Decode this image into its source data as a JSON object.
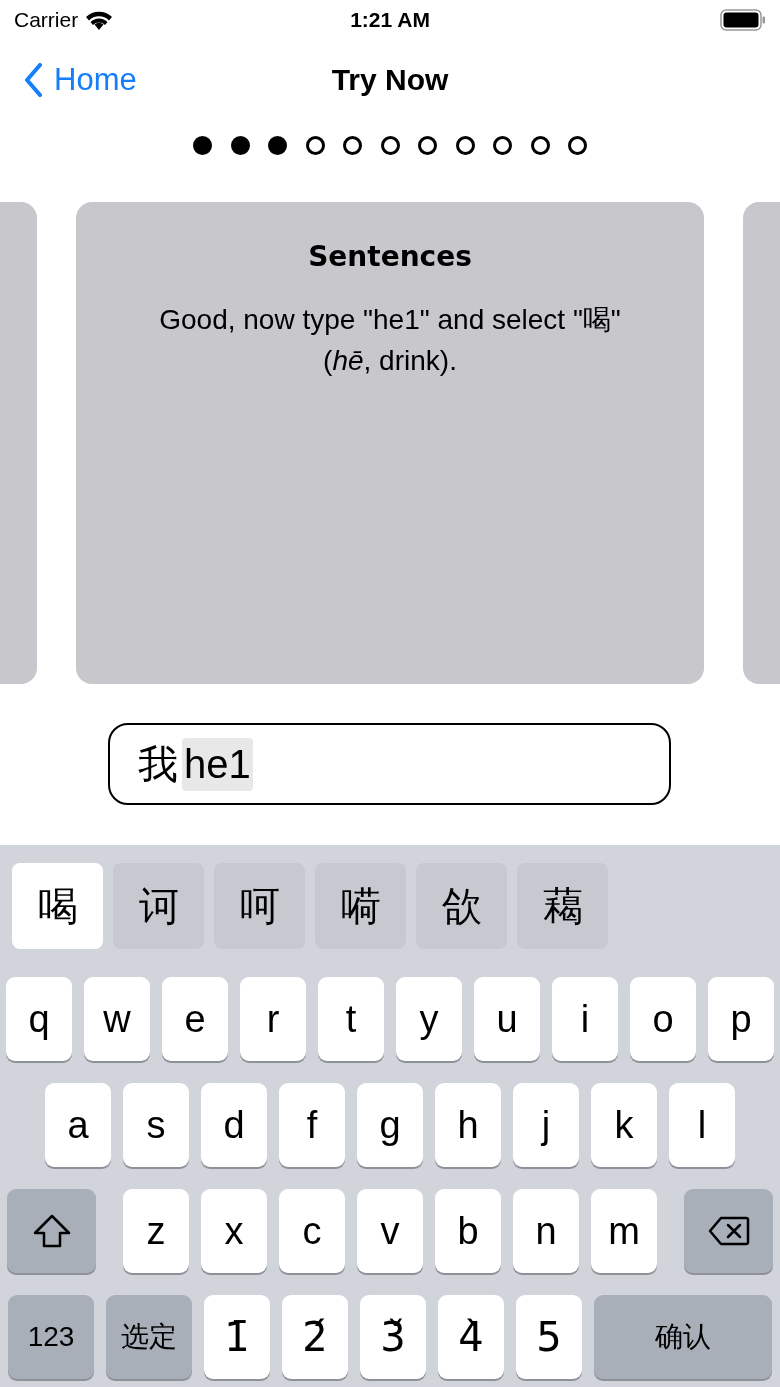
{
  "status_bar": {
    "carrier": "Carrier",
    "time": "1:21 AM"
  },
  "nav_bar": {
    "back_label": "Home",
    "title": "Try Now"
  },
  "page_dots": [
    {
      "done": true
    },
    {
      "done": true
    },
    {
      "done": true
    },
    {
      "done": false
    },
    {
      "done": false
    },
    {
      "done": false
    },
    {
      "done": false
    },
    {
      "done": false
    },
    {
      "done": false
    },
    {
      "done": false
    },
    {
      "done": false
    }
  ],
  "cards": [
    {
      "kind": "peek"
    },
    {
      "kind": "lesson",
      "title": "Sentences",
      "body": "Good, now type \"he1\" and select \"喝\" (*hē*, drink)."
    },
    {
      "kind": "peek"
    }
  ],
  "input": {
    "committed": "我",
    "composing": "he1"
  },
  "keyboard": {
    "candidates": [
      {
        "label": "喝",
        "selected": true
      },
      {
        "label": "诃",
        "selected": false
      },
      {
        "label": "呵",
        "selected": false
      },
      {
        "label": "嗬",
        "selected": false
      },
      {
        "label": "欱",
        "selected": false
      },
      {
        "label": "藒",
        "selected": false
      }
    ],
    "rows": [
      {
        "keys": [
          {
            "kind": "letter",
            "label": "q"
          },
          {
            "kind": "letter",
            "label": "w"
          },
          {
            "kind": "letter",
            "label": "e"
          },
          {
            "kind": "letter",
            "label": "r"
          },
          {
            "kind": "letter",
            "label": "t"
          },
          {
            "kind": "letter",
            "label": "y"
          },
          {
            "kind": "letter",
            "label": "u"
          },
          {
            "kind": "letter",
            "label": "i"
          },
          {
            "kind": "letter",
            "label": "o"
          },
          {
            "kind": "letter",
            "label": "p"
          }
        ]
      },
      {
        "keys": [
          {
            "kind": "letter",
            "label": "a"
          },
          {
            "kind": "letter",
            "label": "s"
          },
          {
            "kind": "letter",
            "label": "d"
          },
          {
            "kind": "letter",
            "label": "f"
          },
          {
            "kind": "letter",
            "label": "g"
          },
          {
            "kind": "letter",
            "label": "h"
          },
          {
            "kind": "letter",
            "label": "j"
          },
          {
            "kind": "letter",
            "label": "k"
          },
          {
            "kind": "letter",
            "label": "l"
          }
        ]
      },
      {
        "keys": [
          {
            "kind": "shift"
          },
          {
            "kind": "letter",
            "label": "z"
          },
          {
            "kind": "letter",
            "label": "x"
          },
          {
            "kind": "letter",
            "label": "c"
          },
          {
            "kind": "letter",
            "label": "v"
          },
          {
            "kind": "letter",
            "label": "b"
          },
          {
            "kind": "letter",
            "label": "n"
          },
          {
            "kind": "letter",
            "label": "m"
          },
          {
            "kind": "delete"
          }
        ]
      },
      {
        "keys": [
          {
            "kind": "mode",
            "label": "123"
          },
          {
            "kind": "mode",
            "label": "选定"
          },
          {
            "kind": "tone",
            "label": "1̄"
          },
          {
            "kind": "tone",
            "label": "2́"
          },
          {
            "kind": "tone",
            "label": "3̌"
          },
          {
            "kind": "tone",
            "label": "4̀"
          },
          {
            "kind": "tone",
            "label": "5"
          },
          {
            "kind": "action",
            "label": "确认"
          }
        ]
      }
    ]
  }
}
